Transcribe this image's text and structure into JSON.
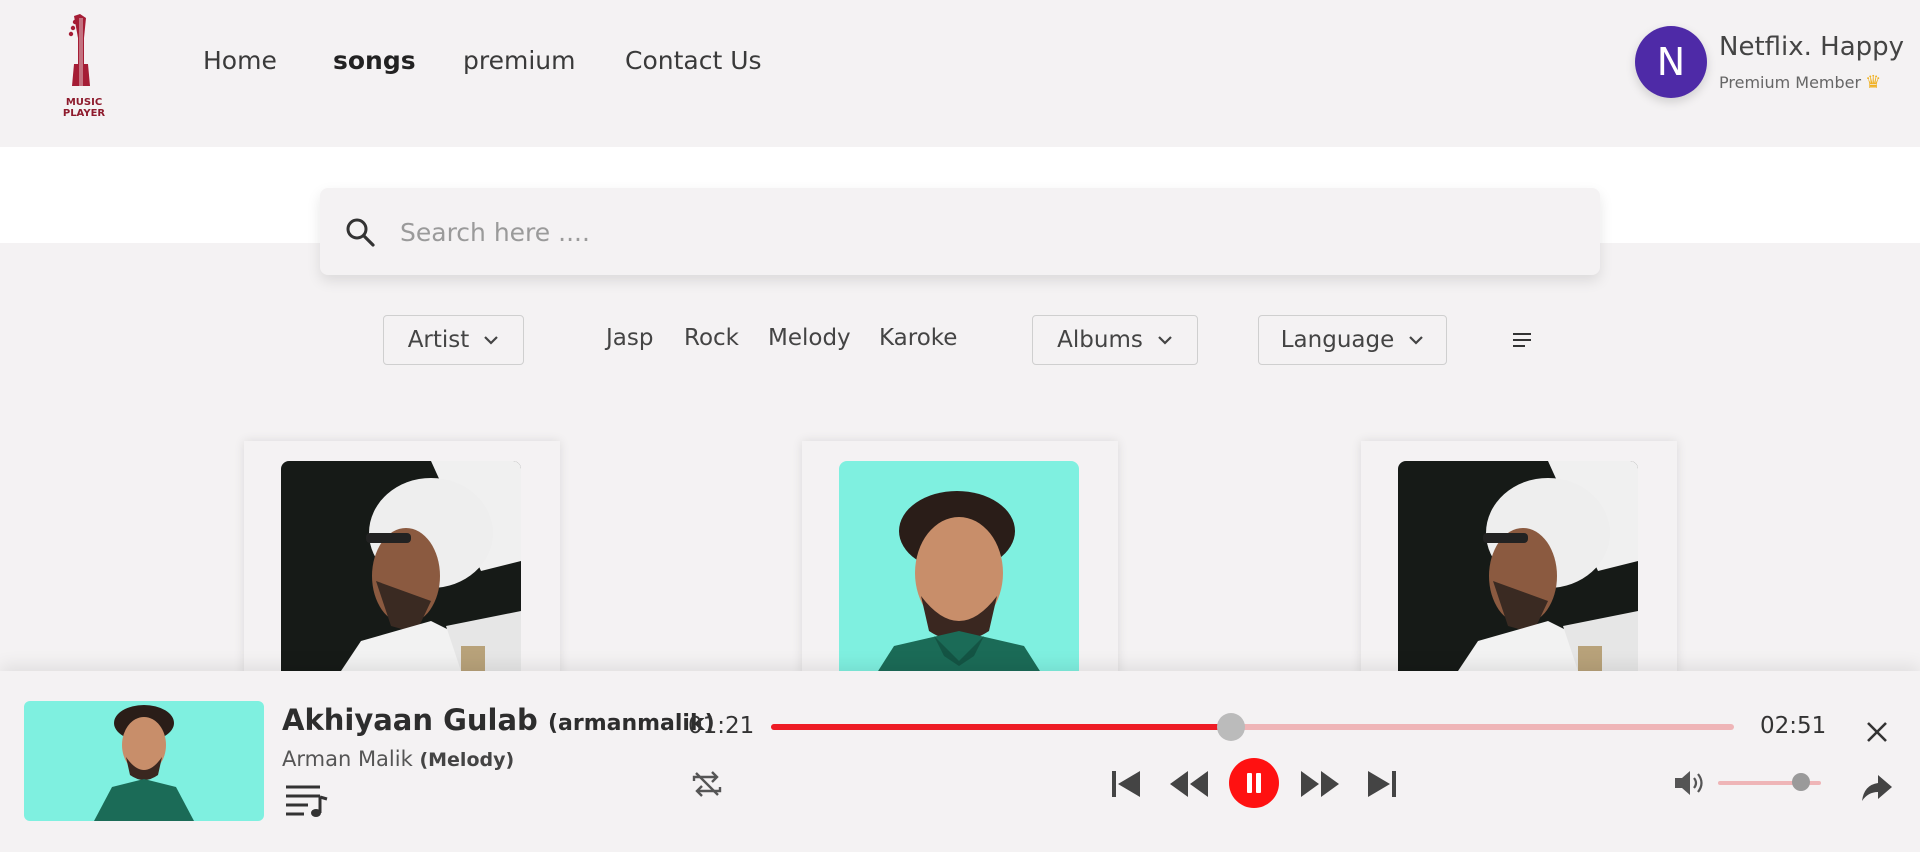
{
  "logo": {
    "text": "MUSIC PLAYER",
    "color": "#8e1b2d"
  },
  "nav": {
    "items": [
      {
        "label": "Home",
        "active": false
      },
      {
        "label": "songs",
        "active": true
      },
      {
        "label": "premium",
        "active": false
      },
      {
        "label": "Contact Us",
        "active": false
      }
    ]
  },
  "profile": {
    "initial": "N",
    "name": "Netflix. Happy",
    "membership": "Premium Member",
    "avatar_color": "#4e2aa7"
  },
  "search": {
    "placeholder": "Search here ...."
  },
  "filters": {
    "artist_label": "Artist",
    "tags": [
      "Jasp",
      "Rock",
      "Melody",
      "Karoke"
    ],
    "albums_label": "Albums",
    "language_label": "Language"
  },
  "cards": [
    {
      "artist_image": "turban-artist-portrait"
    },
    {
      "artist_image": "armaan-malik-portrait"
    },
    {
      "artist_image": "turban-artist-portrait"
    }
  ],
  "player": {
    "title": "Akhiyaan Gulab",
    "title_tag": "(armanmalik)",
    "artist": "Arman Malik",
    "genre": "(Melody)",
    "current_time": "01:21",
    "total_time": "02:51",
    "progress_percent": 47.8,
    "volume_percent": 81,
    "is_playing": true,
    "accent_color": "#ee1c25"
  }
}
